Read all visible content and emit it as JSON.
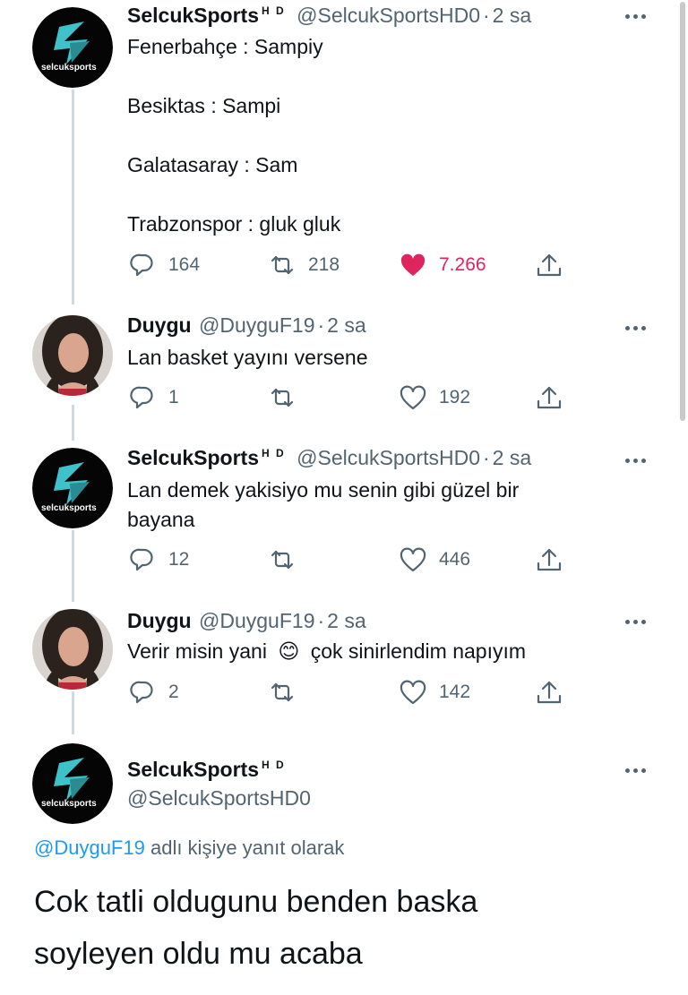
{
  "tweets": [
    {
      "name": "SelcukSports",
      "badge": "H D",
      "handle": "@SelcukSportsHD0",
      "dot": "·",
      "time": "2 sa",
      "lines": [
        "Fenerbahçe : Sampiy",
        "Besiktas : Sampi",
        "Galatasaray : Sam",
        "Trabzonspor : gluk gluk"
      ],
      "replies": "164",
      "retweets": "218",
      "likes": "7.266",
      "liked": true
    },
    {
      "name": "Duygu",
      "handle": "@DuyguF19",
      "dot": "·",
      "time": "2 sa",
      "lines": [
        "Lan basket yayını versene"
      ],
      "replies": "1",
      "retweets": "",
      "likes": "192"
    },
    {
      "name": "SelcukSports",
      "badge": "H D",
      "handle": "@SelcukSportsHD0",
      "dot": "·",
      "time": "2 sa",
      "lines": [
        "Lan demek yakisiyo mu senin gibi güzel bir",
        "bayana"
      ],
      "replies": "12",
      "retweets": "",
      "likes": "446"
    },
    {
      "name": "Duygu",
      "handle": "@DuyguF19",
      "dot": "·",
      "time": "2 sa",
      "lines": [
        "Verir misin yani",
        "çok sinirlendim napıyım"
      ],
      "emoji": "😊",
      "replies": "2",
      "retweets": "",
      "likes": "142"
    }
  ],
  "focused": {
    "name": "SelcukSports",
    "badge": "H D",
    "handle": "@SelcukSportsHD0",
    "reply_to_handle": "@DuyguF19",
    "reply_to_text": "adlı kişiye yanıt olarak",
    "lines": [
      "Cok tatli oldugunu benden baska",
      "soyleyen oldu mu acaba"
    ]
  },
  "logo_text": "selcuksports",
  "colors": {
    "text": "#0f1419",
    "secondary": "#536471",
    "link": "#1d9bf0",
    "like": "#e0245e",
    "logo_accent": "#3fc1c9"
  },
  "icons": [
    "reply-icon",
    "retweet-icon",
    "like-icon",
    "share-icon",
    "more-icon"
  ]
}
